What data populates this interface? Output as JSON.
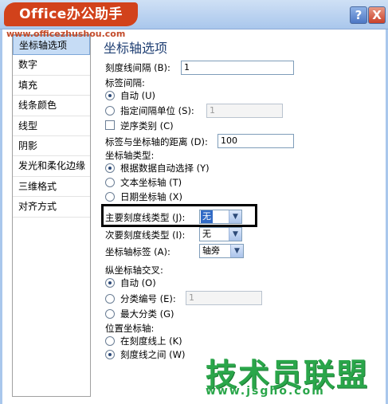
{
  "window": {
    "logo_text": "Office办公助手",
    "watermark_url": "www.officezhushou.com",
    "help_glyph": "?",
    "close_glyph": "X"
  },
  "nav": {
    "items": [
      {
        "label": "坐标轴选项",
        "selected": true
      },
      {
        "label": "数字"
      },
      {
        "label": "填充"
      },
      {
        "label": "线条颜色"
      },
      {
        "label": "线型"
      },
      {
        "label": "阴影"
      },
      {
        "label": "发光和柔化边缘"
      },
      {
        "label": "三维格式"
      },
      {
        "label": "对齐方式"
      }
    ]
  },
  "panel": {
    "title": "坐标轴选项",
    "tick_interval": {
      "label": "刻度线间隔 (B):",
      "value": "1"
    },
    "label_interval": {
      "label": "标签间隔:",
      "auto": "自动 (U)",
      "specify": "指定间隔单位 (S):",
      "specify_value": "1",
      "selected": "auto"
    },
    "reverse_order": {
      "label": "逆序类别 (C)",
      "checked": false
    },
    "label_distance": {
      "label": "标签与坐标轴的距离 (D):",
      "value": "100"
    },
    "axis_type": {
      "label": "坐标轴类型:",
      "options": [
        "根据数据自动选择 (Y)",
        "文本坐标轴 (T)",
        "日期坐标轴 (X)"
      ],
      "selected": 0
    },
    "major_tick_type": {
      "label": "主要刻度线类型 (J):",
      "value": "无"
    },
    "minor_tick_type": {
      "label": "次要刻度线类型 (I):",
      "value": "无"
    },
    "axis_labels": {
      "label": "坐标轴标签 (A):",
      "value": "轴旁"
    },
    "vertical_crosses": {
      "label": "纵坐标轴交叉:",
      "auto": "自动 (O)",
      "category_number": "分类编号 (E):",
      "category_number_value": "1",
      "max_category": "最大分类 (G)",
      "selected": "auto"
    },
    "axis_position": {
      "label": "位置坐标轴:",
      "on_tick": "在刻度线上 (K)",
      "between_tick": "刻度线之间 (W)",
      "selected": "between_tick"
    }
  },
  "brand": {
    "name": "技术员联盟",
    "url": "www.jsgho.com"
  }
}
